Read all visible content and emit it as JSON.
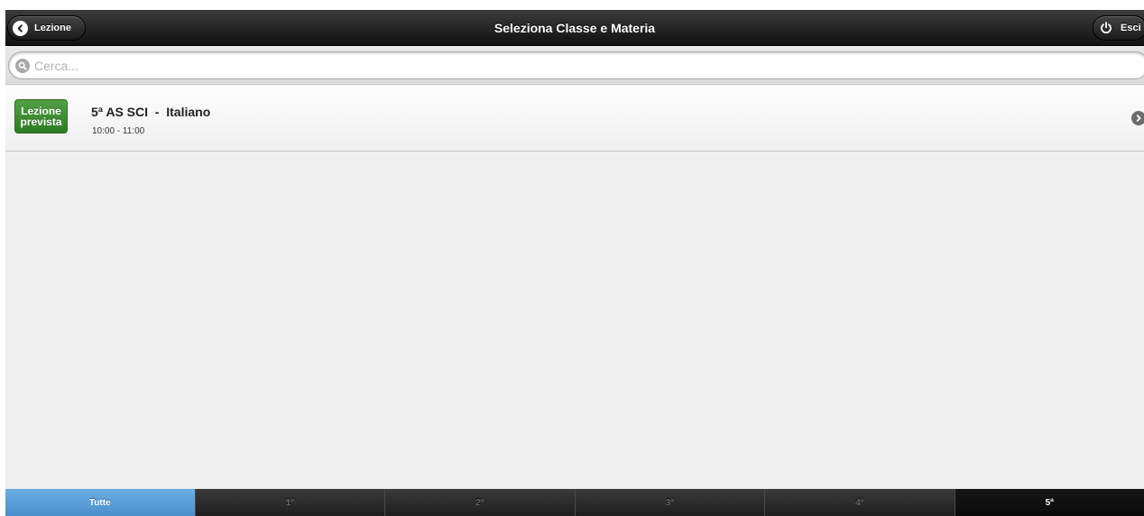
{
  "header": {
    "title": "Seleziona Classe e Materia",
    "back_label": "Lezione",
    "exit_label": "Esci"
  },
  "search": {
    "placeholder": "Cerca...",
    "value": ""
  },
  "list": {
    "items": [
      {
        "badge_line1": "Lezione",
        "badge_line2": "prevista",
        "badge_color": "#3a8a2f",
        "title": "5ª AS SCI  -  Italiano",
        "time": "10:00 - 11:00"
      }
    ]
  },
  "tabs": [
    {
      "label": "Tutte",
      "state": "highlighted"
    },
    {
      "label": "1ª",
      "state": "normal"
    },
    {
      "label": "2ª",
      "state": "normal"
    },
    {
      "label": "3ª",
      "state": "normal"
    },
    {
      "label": "4ª",
      "state": "normal"
    },
    {
      "label": "5ª",
      "state": "selected"
    }
  ],
  "colors": {
    "header_bg": "#1a1a1a",
    "tab_highlight": "#5a9fd8",
    "body_bg": "#efefef"
  },
  "icons": {
    "back": "chevron-left-icon",
    "exit": "power-icon",
    "search": "search-icon",
    "row_arrow": "chevron-right-icon"
  }
}
